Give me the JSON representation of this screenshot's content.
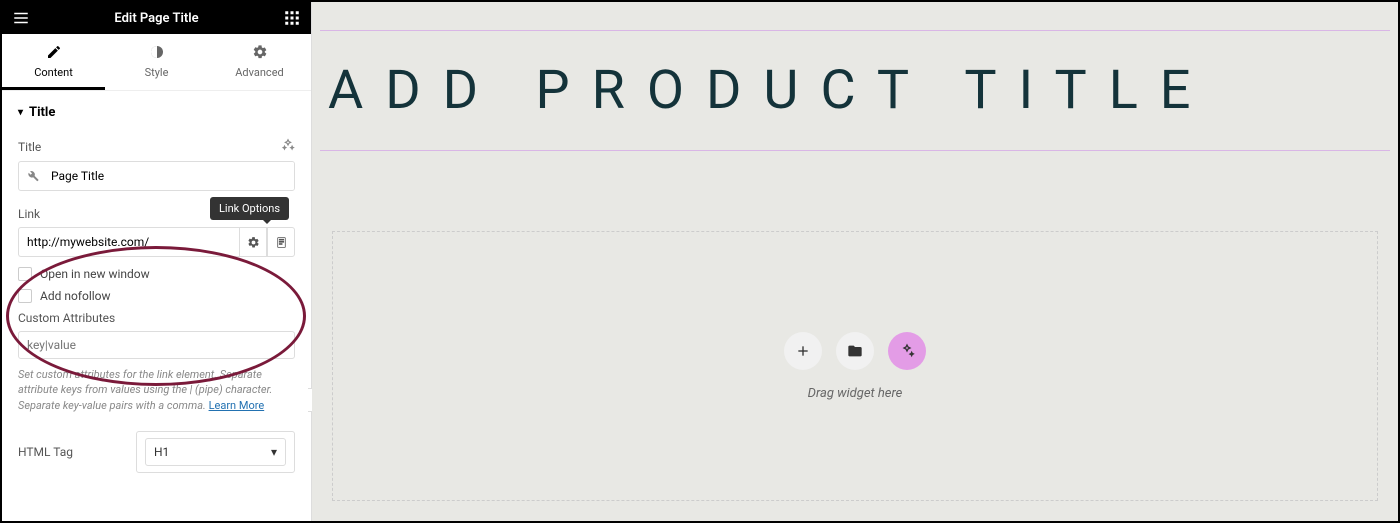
{
  "header": {
    "title": "Edit Page Title"
  },
  "tabs": {
    "content": "Content",
    "style": "Style",
    "advanced": "Advanced"
  },
  "section": {
    "title": "Title"
  },
  "fields": {
    "title_label": "Title",
    "title_value": "Page Title",
    "link_label": "Link",
    "link_value": "http://mywebsite.com/",
    "link_tooltip": "Link Options",
    "open_new": "Open in new window",
    "nofollow": "Add nofollow",
    "custom_attr_label": "Custom Attributes",
    "custom_attr_placeholder": "key|value",
    "help_text": "Set custom attributes for the link element. Separate attribute keys from values using the | (pipe) character. Separate key-value pairs with a comma.",
    "learn_more": "Learn More",
    "html_tag_label": "HTML Tag",
    "html_tag_value": "H1"
  },
  "canvas": {
    "product_title": "ADD PRODUCT TITLE",
    "drop_text": "Drag widget here"
  }
}
